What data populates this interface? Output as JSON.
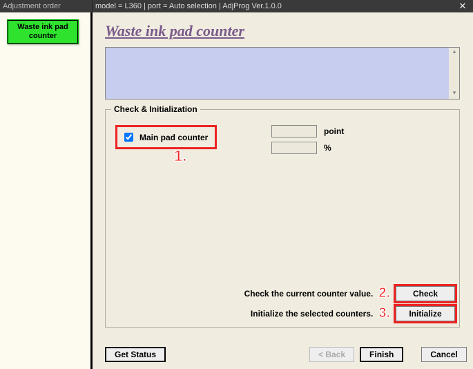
{
  "titlebar": {
    "left": "Adjustment order",
    "right": "model = L360 | port = Auto selection | AdjProg Ver.1.0.0"
  },
  "sidebar": {
    "waste_btn": "Waste ink pad counter"
  },
  "page": {
    "title": "Waste ink pad counter"
  },
  "fieldset": {
    "legend": "Check & Initialization",
    "main_pad_label": "Main pad counter",
    "unit_point": "point",
    "unit_percent": "%",
    "point_value": "",
    "percent_value": ""
  },
  "actions": {
    "check_text": "Check the current counter value.",
    "init_text": "Initialize the selected counters.",
    "check_btn": "Check",
    "init_btn": "Initialize"
  },
  "footer": {
    "get_status": "Get Status",
    "back": "< Back",
    "finish": "Finish",
    "cancel": "Cancel"
  },
  "callouts": {
    "c1": "1.",
    "c2": "2.",
    "c3": "3."
  }
}
